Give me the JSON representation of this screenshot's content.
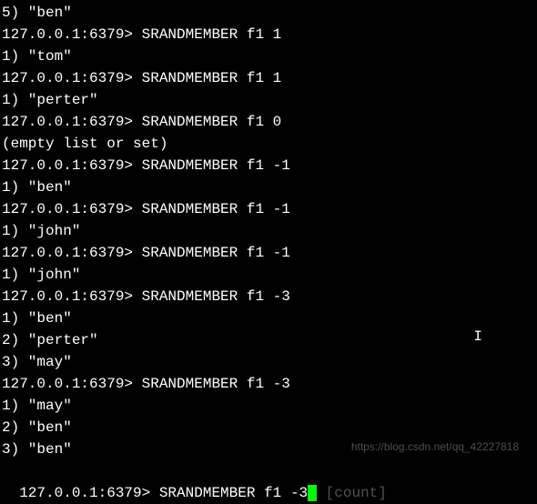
{
  "lines": [
    {
      "text": "5) \"ben\""
    },
    {
      "prompt": "127.0.0.1:6379> ",
      "command": "SRANDMEMBER f1 1"
    },
    {
      "text": "1) \"tom\""
    },
    {
      "prompt": "127.0.0.1:6379> ",
      "command": "SRANDMEMBER f1 1"
    },
    {
      "text": "1) \"perter\""
    },
    {
      "prompt": "127.0.0.1:6379> ",
      "command": "SRANDMEMBER f1 0"
    },
    {
      "text": "(empty list or set)"
    },
    {
      "prompt": "127.0.0.1:6379> ",
      "command": "SRANDMEMBER f1 -1"
    },
    {
      "text": "1) \"ben\""
    },
    {
      "prompt": "127.0.0.1:6379> ",
      "command": "SRANDMEMBER f1 -1"
    },
    {
      "text": "1) \"john\""
    },
    {
      "prompt": "127.0.0.1:6379> ",
      "command": "SRANDMEMBER f1 -1"
    },
    {
      "text": "1) \"john\""
    },
    {
      "prompt": "127.0.0.1:6379> ",
      "command": "SRANDMEMBER f1 -3"
    },
    {
      "text": "1) \"ben\""
    },
    {
      "text": "2) \"perter\""
    },
    {
      "text": "3) \"may\""
    },
    {
      "prompt": "127.0.0.1:6379> ",
      "command": "SRANDMEMBER f1 -3"
    },
    {
      "text": "1) \"may\""
    },
    {
      "text": "2) \"ben\""
    },
    {
      "text": "3) \"ben\""
    }
  ],
  "lastLine": {
    "prompt": "127.0.0.1:6379> ",
    "command": "SRANDMEMBER f1 -3",
    "hint": " [count]"
  },
  "watermark": "https://blog.csdn.net/qq_42227818",
  "ibeam": "I"
}
